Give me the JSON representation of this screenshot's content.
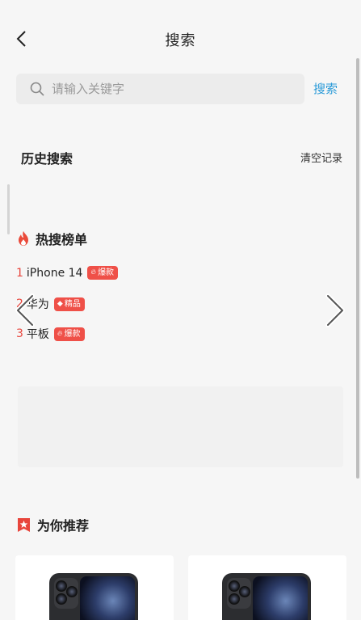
{
  "header": {
    "title": "搜索"
  },
  "search": {
    "placeholder": "请输入关键字",
    "value": "",
    "button_label": "搜索"
  },
  "history": {
    "title": "历史搜索",
    "clear_label": "清空记录"
  },
  "hot": {
    "title": "热搜榜单",
    "items": [
      {
        "rank": "1",
        "label": "iPhone 14",
        "badge": "爆款",
        "badge_icon": "flame-icon"
      },
      {
        "rank": "2",
        "label": "华为",
        "badge": "精品",
        "badge_icon": "gem-icon"
      },
      {
        "rank": "3",
        "label": "平板",
        "badge": "爆款",
        "badge_icon": "flame-icon"
      }
    ]
  },
  "recommend": {
    "title": "为你推荐"
  },
  "colors": {
    "accent_blue": "#2b9bd8",
    "hot_red": "#ef5048",
    "background": "#f6f6f6"
  }
}
